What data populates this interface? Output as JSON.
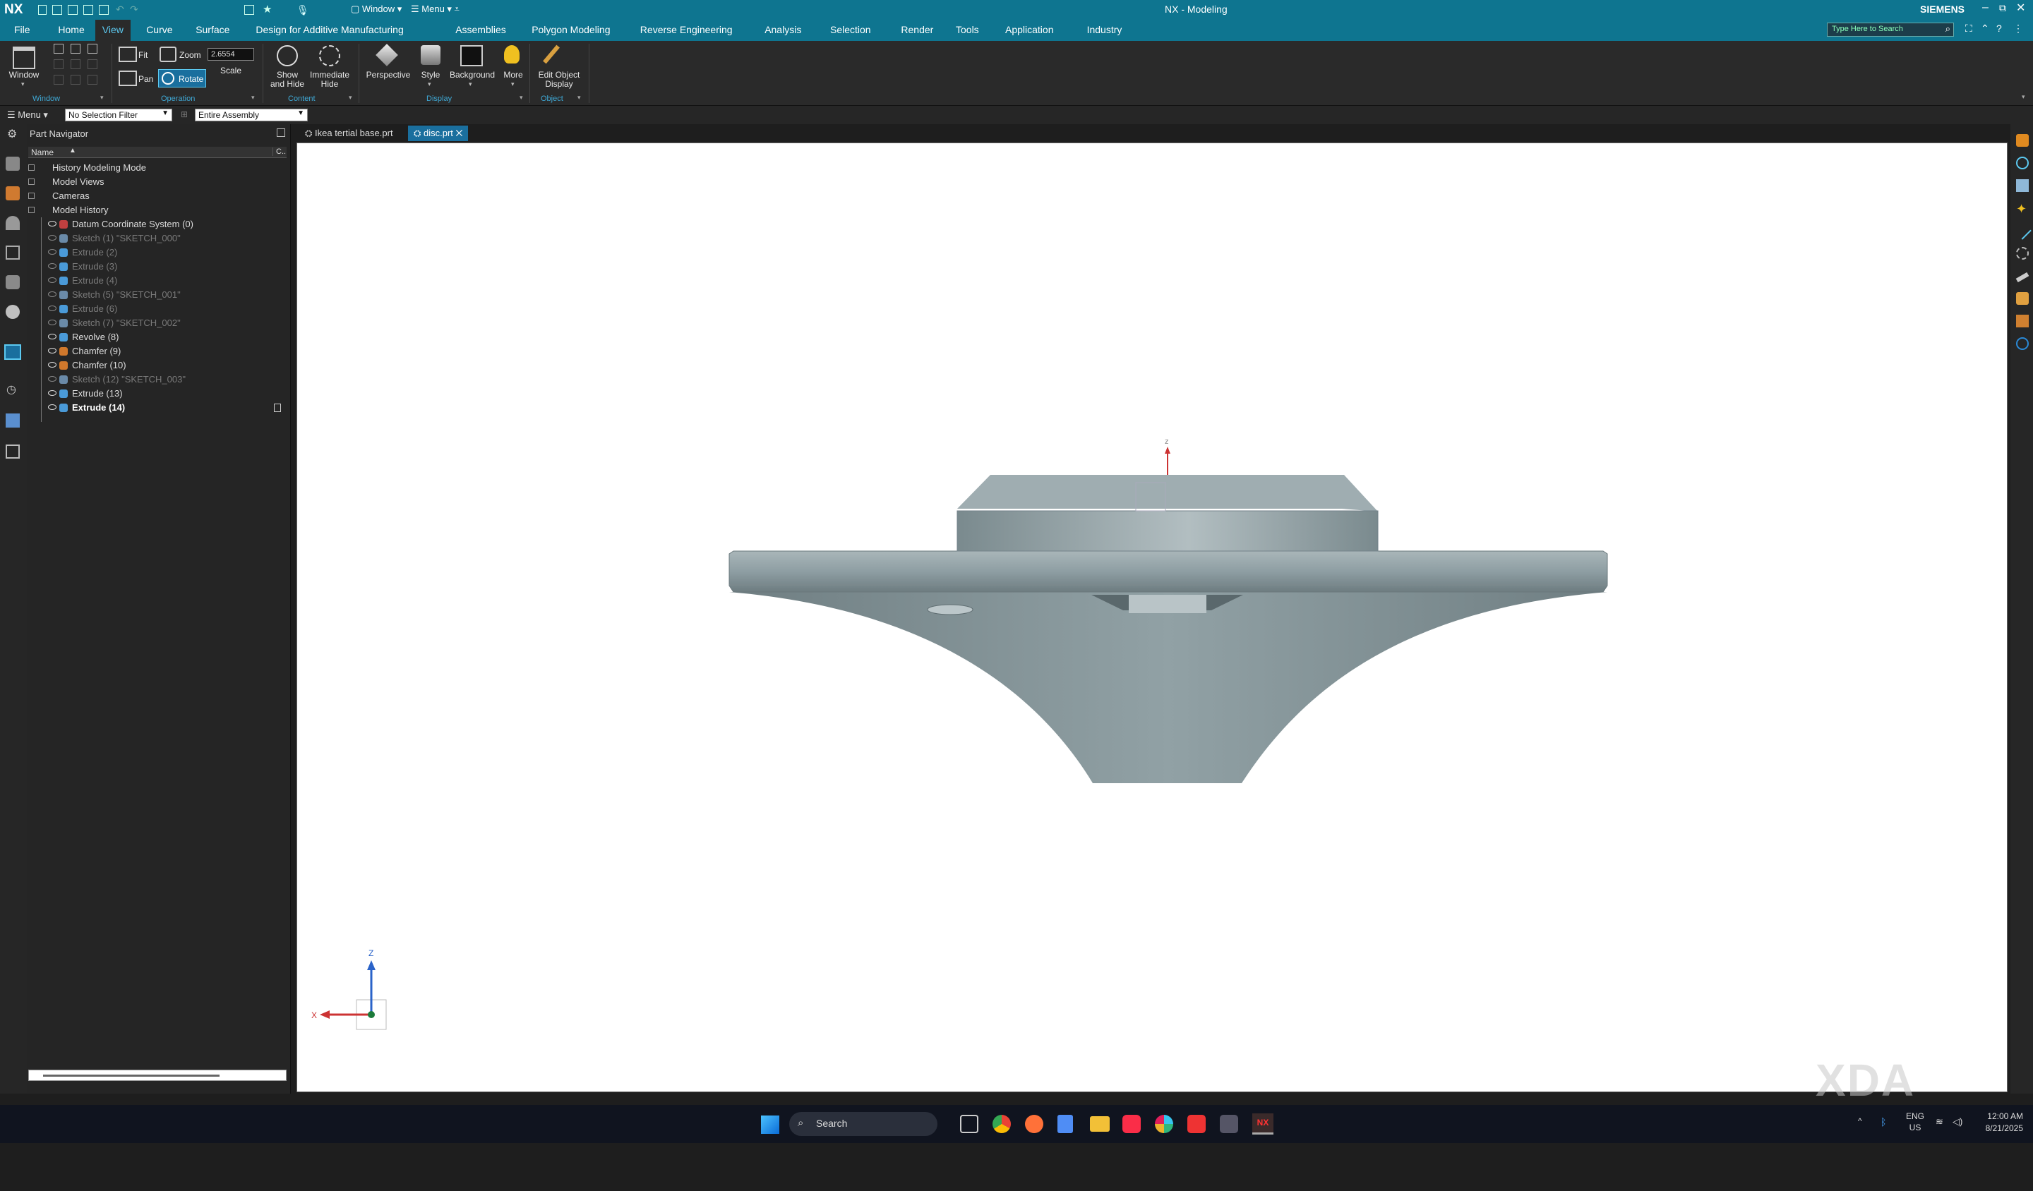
{
  "app": {
    "logo": "NX",
    "title": "NX - Modeling",
    "brand": "SIEMENS",
    "search_placeholder": "Type Here to Search",
    "qat_window": "Window",
    "qat_menu": "Menu"
  },
  "menu": {
    "items": [
      "File",
      "Home",
      "View",
      "Curve",
      "Surface",
      "Design for Additive Manufacturing",
      "Assemblies",
      "Polygon Modeling",
      "Reverse Engineering",
      "Analysis",
      "Selection",
      "Render",
      "Tools",
      "Application",
      "Industry"
    ],
    "active": "View"
  },
  "ribbon": {
    "window": {
      "label": "Window",
      "group": "Window"
    },
    "operation": {
      "fit": "Fit",
      "zoom": "Zoom",
      "zoom_value": "2.6554",
      "scale": "Scale",
      "pan": "Pan",
      "rotate": "Rotate",
      "group": "Operation"
    },
    "content": {
      "show_hide": "Show\nand Hide",
      "immediate_hide": "Immediate\nHide",
      "group": "Content"
    },
    "display": {
      "perspective": "Perspective",
      "style": "Style",
      "background": "Background",
      "more": "More",
      "group": "Display"
    },
    "object": {
      "edit_display": "Edit Object\nDisplay",
      "group": "Object"
    }
  },
  "selection_bar": {
    "menu": "Menu",
    "filter": "No Selection Filter",
    "scope": "Entire Assembly"
  },
  "navigator": {
    "title": "Part Navigator",
    "col_name": "Name",
    "col_c": "C..",
    "rows": [
      {
        "text": "History Modeling Mode",
        "level": 0,
        "dim": false,
        "bold": false
      },
      {
        "text": "Model Views",
        "level": 0,
        "dim": false,
        "bold": false
      },
      {
        "text": "Cameras",
        "level": 0,
        "dim": false,
        "bold": false
      },
      {
        "text": "Model History",
        "level": 0,
        "dim": false,
        "bold": false
      },
      {
        "text": "Datum Coordinate System (0)",
        "level": 1,
        "dim": false,
        "bold": false
      },
      {
        "text": "Sketch (1) \"SKETCH_000\"",
        "level": 1,
        "dim": true,
        "bold": false
      },
      {
        "text": "Extrude (2)",
        "level": 1,
        "dim": true,
        "bold": false
      },
      {
        "text": "Extrude (3)",
        "level": 1,
        "dim": true,
        "bold": false
      },
      {
        "text": "Extrude (4)",
        "level": 1,
        "dim": true,
        "bold": false
      },
      {
        "text": "Sketch (5) \"SKETCH_001\"",
        "level": 1,
        "dim": true,
        "bold": false
      },
      {
        "text": "Extrude (6)",
        "level": 1,
        "dim": true,
        "bold": false
      },
      {
        "text": "Sketch (7) \"SKETCH_002\"",
        "level": 1,
        "dim": true,
        "bold": false
      },
      {
        "text": "Revolve (8)",
        "level": 1,
        "dim": false,
        "bold": false
      },
      {
        "text": "Chamfer (9)",
        "level": 1,
        "dim": false,
        "bold": false
      },
      {
        "text": "Chamfer (10)",
        "level": 1,
        "dim": false,
        "bold": false
      },
      {
        "text": "Sketch (12) \"SKETCH_003\"",
        "level": 1,
        "dim": true,
        "bold": false
      },
      {
        "text": "Extrude (13)",
        "level": 1,
        "dim": false,
        "bold": false
      },
      {
        "text": "Extrude (14)",
        "level": 1,
        "dim": false,
        "bold": true
      }
    ]
  },
  "tabs": [
    {
      "label": "Ikea tertial base.prt",
      "active": false
    },
    {
      "label": "disc.prt",
      "active": true
    }
  ],
  "triad": {
    "z": "Z",
    "x": "X"
  },
  "watermark": "XDA",
  "taskbar": {
    "search": "Search",
    "lang1": "ENG",
    "lang2": "US",
    "time": "12:00 AM",
    "date": "8/21/2025"
  },
  "colors": {
    "accent": "#0e7590",
    "active_tab": "#1a6f9e",
    "model": "#8e9ea3"
  }
}
